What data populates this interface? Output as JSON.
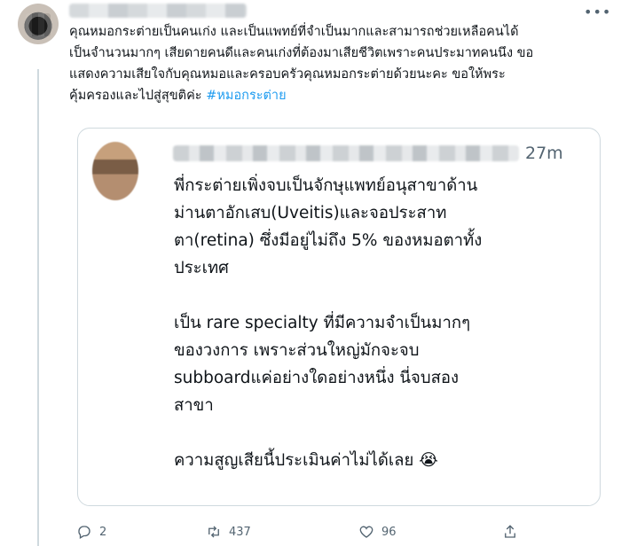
{
  "tweet": {
    "text_lines": [
      "คุณหมอกระต่ายเป็นคนเก่ง และเป็นแพทย์ที่จำเป็นมากและสามารถช่วยเหลือคนได้",
      "เป็นจำนวนมากๆ เสียดายคนดีและคนเก่งที่ต้องมาเสียชีวิตเพราะคนประมาทคนนึง ขอ",
      "แสดงความเสียใจกับคุณหมอและครอบครัวคุณหมอกระต่ายด้วยนะคะ ขอให้พระ",
      "คุ้มครองและไปสู่สุขติค่ะ"
    ],
    "hashtag": "#หมอกระต่าย"
  },
  "quote": {
    "time": "27m",
    "lines": [
      "พี่กระต่ายเพิ่งจบเป็นจักษุแพทย์อนุสาขาด้าน",
      "ม่านตาอักเสบ(Uveitis)และจอประสาท",
      "ตา(retina) ซึ่งมีอยู่ไม่ถึง 5% ของหมอตาทั้ง",
      "ประเทศ",
      "",
      "เป็น rare specialty ที่มีความจำเป็นมากๆ",
      "ของวงการ เพราะส่วนใหญ่มักจะจบ",
      "subboardแค่อย่างใดอย่างหนึ่ง นี่จบสอง",
      "สาขา",
      "",
      "ความสูญเสียนี้ประเมินค่าไม่ได้เลย 😭"
    ]
  },
  "actions": {
    "reply_count": "2",
    "retweet_count": "437",
    "like_count": "96"
  },
  "icons": [
    "reply-icon",
    "retweet-icon",
    "like-icon",
    "share-icon",
    "more-icon"
  ],
  "colors": {
    "link": "#1d9bf0",
    "muted": "#536471",
    "border": "#cfd9de",
    "text": "#0f1419"
  }
}
